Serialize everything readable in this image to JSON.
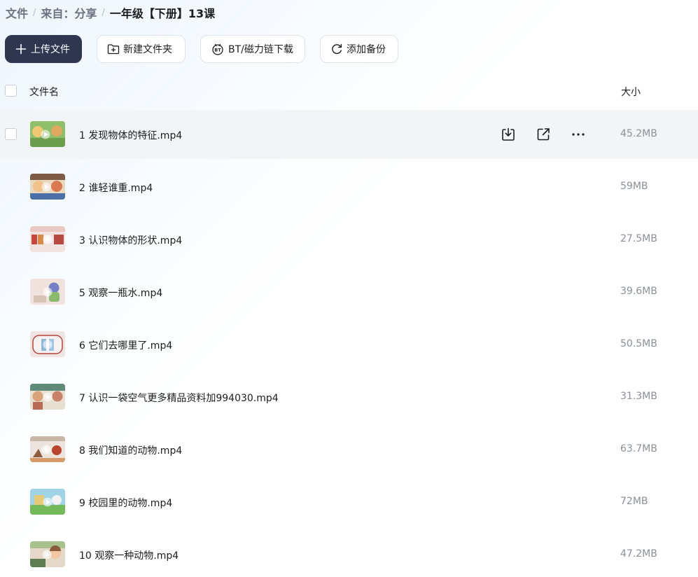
{
  "breadcrumb": {
    "items": [
      "文件",
      "来自：分享"
    ],
    "separator": "/",
    "current": "一年级【下册】13课"
  },
  "toolbar": {
    "upload_label": "上传文件",
    "new_folder_label": "新建文件夹",
    "bt_label": "BT/磁力链下载",
    "backup_label": "添加备份"
  },
  "list_header": {
    "name_label": "文件名",
    "size_label": "大小"
  },
  "files": [
    {
      "name": "1 发现物体的特征.mp4",
      "size": "45.2MB",
      "hovered": true
    },
    {
      "name": "2 谁轻谁重.mp4",
      "size": "59MB"
    },
    {
      "name": "3 认识物体的形状.mp4",
      "size": "27.5MB"
    },
    {
      "name": "5 观察一瓶水.mp4",
      "size": "39.6MB"
    },
    {
      "name": "6 它们去哪里了.mp4",
      "size": "50.5MB"
    },
    {
      "name": "7 认识一袋空气更多精品资料加994030.mp4",
      "size": "31.3MB"
    },
    {
      "name": "8 我们知道的动物.mp4",
      "size": "63.7MB"
    },
    {
      "name": "9 校园里的动物.mp4",
      "size": "72MB"
    },
    {
      "name": "10 观察一种动物.mp4",
      "size": "47.2MB"
    }
  ],
  "row_action_icons": [
    "download-icon",
    "share-icon",
    "more-icon"
  ],
  "colors": {
    "primary_button": "#2f3650",
    "hover_row": "#f3f4f6",
    "muted_text": "#8a8f98"
  }
}
